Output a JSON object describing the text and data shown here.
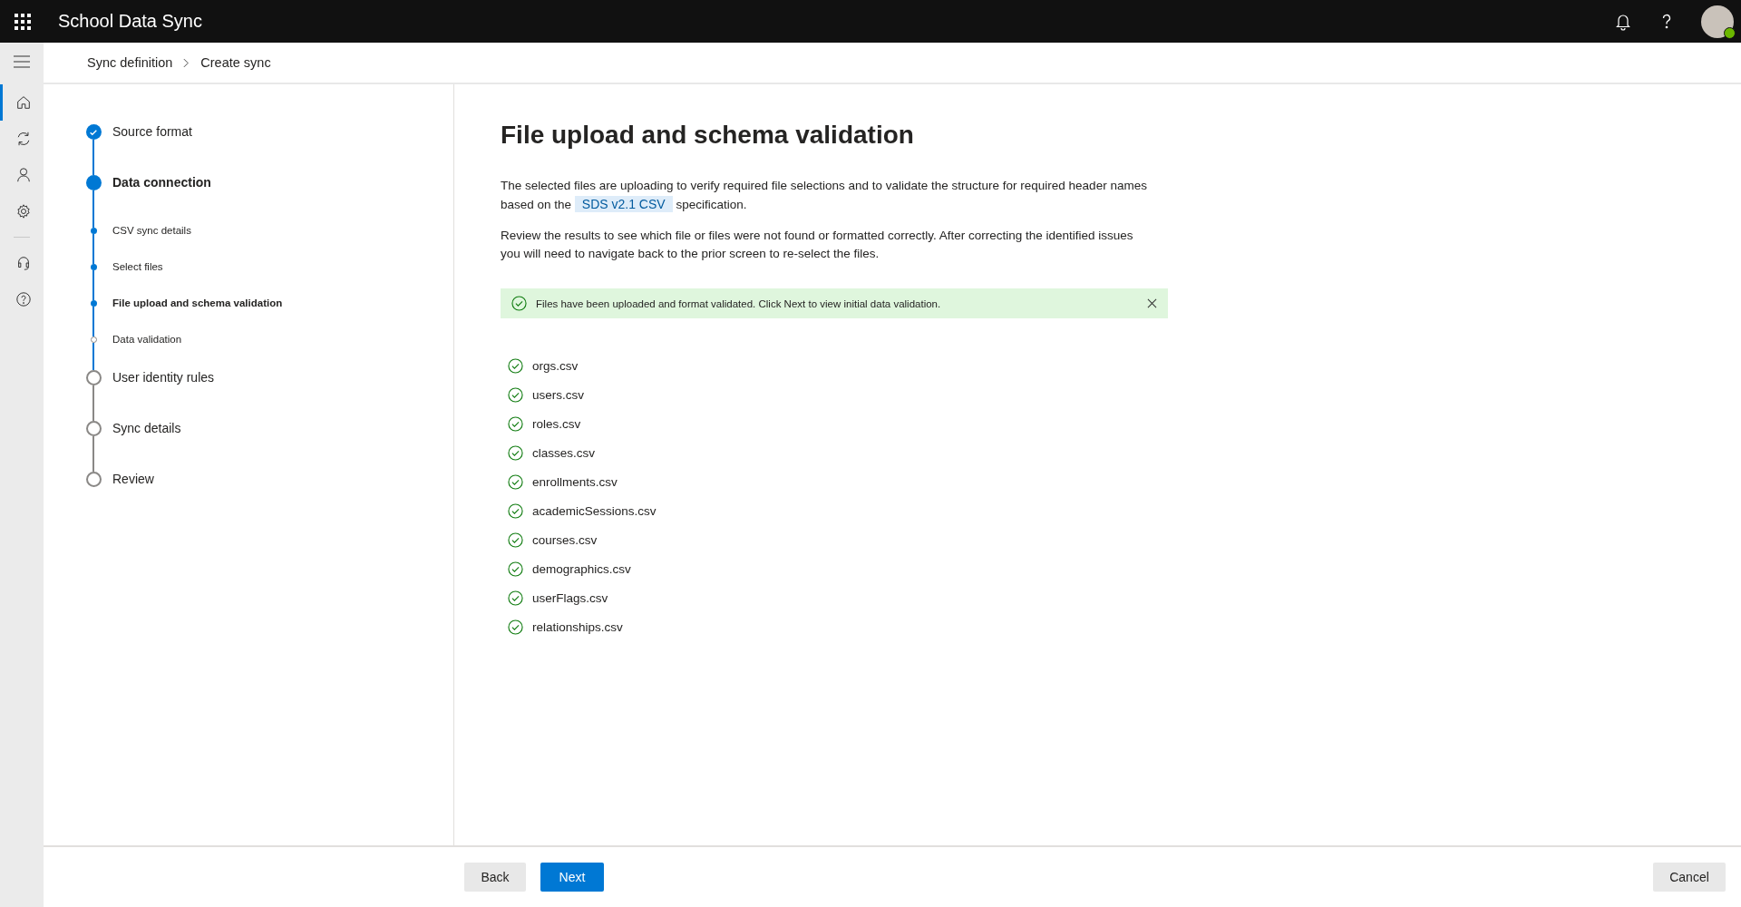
{
  "app": {
    "title": "School Data Sync"
  },
  "rail_items": [
    {
      "kind": "home",
      "selected": true
    },
    {
      "kind": "sync",
      "selected": false
    },
    {
      "kind": "person",
      "selected": false
    },
    {
      "kind": "settings",
      "selected": false
    },
    {
      "kind": "support",
      "selected": false
    },
    {
      "kind": "help",
      "selected": false
    }
  ],
  "breadcrumb": [
    "Sync definition",
    "Create sync"
  ],
  "steps": [
    {
      "label": "Source format",
      "done": true,
      "current": false
    },
    {
      "label": "Data connection",
      "done": false,
      "current": true,
      "children": [
        {
          "label": "CSV sync details",
          "done": true,
          "selected": false
        },
        {
          "label": "Select files",
          "done": true,
          "selected": false
        },
        {
          "label": "File upload and schema validation",
          "done": true,
          "selected": true
        },
        {
          "label": "Data validation",
          "done": false,
          "selected": false
        }
      ]
    },
    {
      "label": "User identity rules",
      "done": false,
      "current": false
    },
    {
      "label": "Sync details",
      "done": false,
      "current": false
    },
    {
      "label": "Review",
      "done": false,
      "current": false
    }
  ],
  "heading": "File upload and schema validation",
  "intro": {
    "before": "The selected files are uploading to verify required file selections and to validate the structure for required header names based on the",
    "link": "SDS v2.1 CSV",
    "after": "specification."
  },
  "note": "Review the results to see which file or files were not found or formatted correctly. After correcting the identified issues you will need to navigate back to the prior screen to re-select the files.",
  "banner": {
    "kind": "success",
    "text": "Files have been uploaded and format validated. Click Next to view initial data validation."
  },
  "files": [
    {
      "name": "orgs.csv",
      "valid": true
    },
    {
      "name": "users.csv",
      "valid": true
    },
    {
      "name": "roles.csv",
      "valid": true
    },
    {
      "name": "classes.csv",
      "valid": true
    },
    {
      "name": "enrollments.csv",
      "valid": true
    },
    {
      "name": "academicSessions.csv",
      "valid": true
    },
    {
      "name": "courses.csv",
      "valid": true
    },
    {
      "name": "demographics.csv",
      "valid": true
    },
    {
      "name": "userFlags.csv",
      "valid": true
    },
    {
      "name": "relationships.csv",
      "valid": true
    }
  ],
  "footer": {
    "back": "Back",
    "next": "Next",
    "cancel": "Cancel"
  }
}
